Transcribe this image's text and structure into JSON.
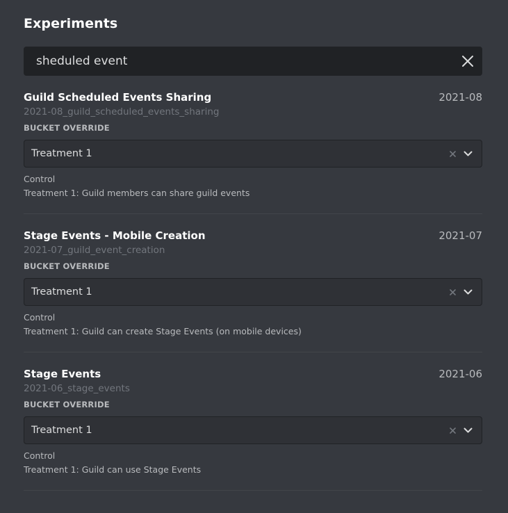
{
  "page": {
    "title": "Experiments"
  },
  "search": {
    "value": "sheduled event"
  },
  "experiments": [
    {
      "name": "Guild Scheduled Events Sharing",
      "date": "2021-08",
      "id": "2021-08_guild_scheduled_events_sharing",
      "bucket_label": "BUCKET OVERRIDE",
      "selected": "Treatment 1",
      "descriptions": [
        "Control",
        "Treatment 1: Guild members can share guild events"
      ]
    },
    {
      "name": "Stage Events - Mobile Creation",
      "date": "2021-07",
      "id": "2021-07_guild_event_creation",
      "bucket_label": "BUCKET OVERRIDE",
      "selected": "Treatment 1",
      "descriptions": [
        "Control",
        "Treatment 1: Guild can create Stage Events (on mobile devices)"
      ]
    },
    {
      "name": "Stage Events",
      "date": "2021-06",
      "id": "2021-06_stage_events",
      "bucket_label": "BUCKET OVERRIDE",
      "selected": "Treatment 1",
      "descriptions": [
        "Control",
        "Treatment 1: Guild can use Stage Events"
      ]
    }
  ],
  "icons": {
    "clear": "close-icon",
    "select_clear": "clear-x-icon",
    "chevron": "chevron-down-icon"
  },
  "colors": {
    "background": "#36393f",
    "input": "#202225",
    "select": "#2f3136",
    "heading": "#ffffff",
    "muted": "#72767d",
    "text": "#b9bbbe"
  }
}
